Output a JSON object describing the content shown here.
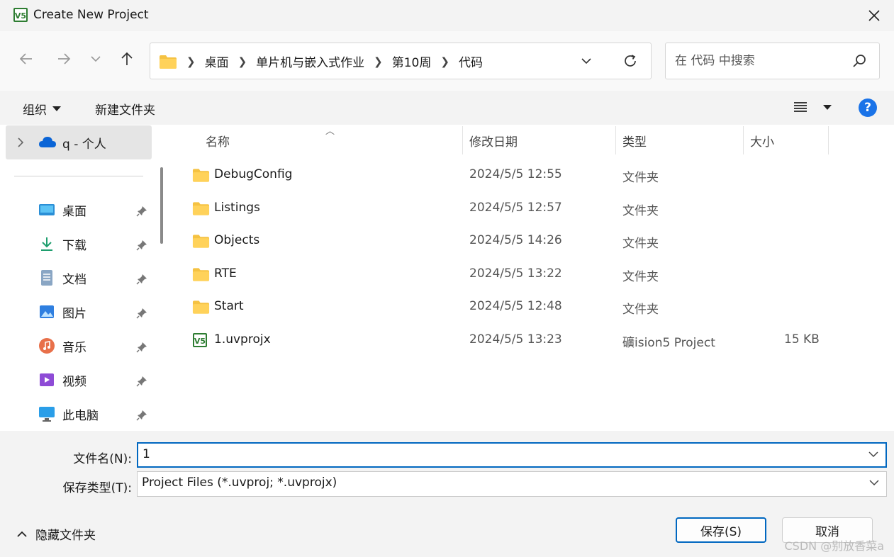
{
  "window": {
    "title": "Create New Project"
  },
  "address": {
    "crumbs": [
      "桌面",
      "单片机与嵌入式作业",
      "第10周",
      "代码"
    ]
  },
  "search": {
    "placeholder": "在 代码 中搜索"
  },
  "toolbar": {
    "organize": "组织",
    "new_folder": "新建文件夹",
    "help": "?"
  },
  "sidebar": {
    "onedrive": "q - 个人",
    "items": [
      {
        "label": "桌面",
        "icon": "desktop-icon"
      },
      {
        "label": "下载",
        "icon": "download-icon"
      },
      {
        "label": "文档",
        "icon": "documents-icon"
      },
      {
        "label": "图片",
        "icon": "pictures-icon"
      },
      {
        "label": "音乐",
        "icon": "music-icon"
      },
      {
        "label": "视频",
        "icon": "videos-icon"
      },
      {
        "label": "此电脑",
        "icon": "computer-icon"
      }
    ]
  },
  "columns": {
    "name": "名称",
    "modified": "修改日期",
    "type": "类型",
    "size": "大小"
  },
  "files": [
    {
      "name": "DebugConfig",
      "modified": "2024/5/5 12:55",
      "type": "文件夹",
      "size": "",
      "icon": "folder-icon"
    },
    {
      "name": "Listings",
      "modified": "2024/5/5 12:57",
      "type": "文件夹",
      "size": "",
      "icon": "folder-icon"
    },
    {
      "name": "Objects",
      "modified": "2024/5/5 14:26",
      "type": "文件夹",
      "size": "",
      "icon": "folder-icon"
    },
    {
      "name": "RTE",
      "modified": "2024/5/5 13:22",
      "type": "文件夹",
      "size": "",
      "icon": "folder-icon"
    },
    {
      "name": "Start",
      "modified": "2024/5/5 12:48",
      "type": "文件夹",
      "size": "",
      "icon": "folder-icon"
    },
    {
      "name": "1.uvprojx",
      "modified": "2024/5/5 13:23",
      "type": "礦ision5 Project",
      "size": "15 KB",
      "icon": "uvision-project-icon"
    }
  ],
  "form": {
    "filename_label": "文件名(N):",
    "filename_value": "1",
    "filetype_label": "保存类型(T):",
    "filetype_value": "Project Files (*.uvproj; *.uvprojx)"
  },
  "footer": {
    "hide_folders": "隐藏文件夹",
    "save": "保存(S)",
    "cancel": "取消",
    "watermark": "CSDN @别放香菜a"
  },
  "colors": {
    "accent": "#0067c0",
    "folder": "#f5c242",
    "uvision": "#2e7d32"
  }
}
